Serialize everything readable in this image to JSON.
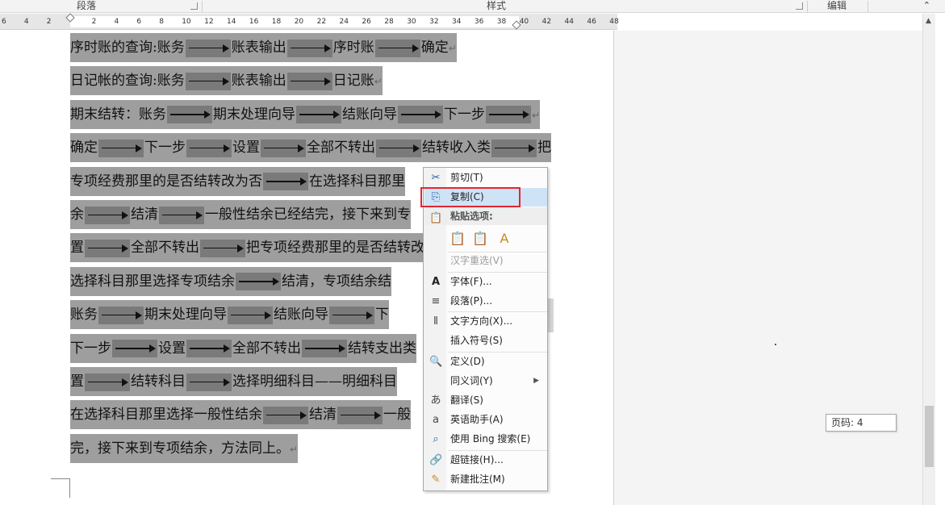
{
  "ribbon": {
    "groups": [
      {
        "label": "段落"
      },
      {
        "label": "样式"
      },
      {
        "label": "编辑"
      }
    ],
    "collapse_icon": "chevron-up-icon"
  },
  "ruler": {
    "ticks": [
      "6",
      "4",
      "2",
      "",
      "2",
      "4",
      "6",
      "8",
      "10",
      "12",
      "14",
      "16",
      "18",
      "20",
      "22",
      "24",
      "26",
      "28",
      "30",
      "32",
      "34",
      "36",
      "38",
      "40",
      "42",
      "44",
      "46",
      "48"
    ]
  },
  "document": {
    "lines": [
      [
        "序时账的查询:账务",
        "→",
        "账表输出",
        "→",
        "序时账",
        "→",
        "确定",
        "↵"
      ],
      [
        "日记帐的查询:账务",
        "→",
        "账表输出",
        "→",
        "日记账",
        "↵"
      ],
      [
        "期末结转：账务",
        "→",
        "期末处理向导",
        "→",
        "结账向导",
        "→",
        "下一步",
        "→",
        "↵"
      ],
      [
        "确定",
        "→",
        "下一步",
        "→",
        "设置",
        "→",
        "全部不转出",
        "→",
        "结转收入类",
        "→",
        "把"
      ],
      [
        "专项经费那里的是否结转改为否",
        "→",
        "在选择科目那里"
      ],
      [
        "余",
        "→",
        "结清",
        "→",
        "一般性结余已经结完，接下来到专"
      ],
      [
        "置",
        "→",
        "全部不转出",
        "→",
        "把专项经费那里的是否结转改"
      ],
      [
        "选择科目那里选择专项结余",
        "→",
        "结清，专项结余结"
      ],
      [
        "账务",
        "→",
        "期末处理向导",
        "→",
        "结账向导",
        "→",
        "下"
      ],
      [
        "下一步",
        "→",
        "设置",
        "→",
        "全部不转出",
        "→",
        "结转支出类"
      ],
      [
        "置",
        "→",
        "结转科目",
        "→",
        "选择明细科目——明细科目"
      ],
      [
        "在选择科目那里选择一般性结余",
        "→",
        "结清",
        "→",
        "一般"
      ],
      [
        "完，接下来到专项结余，方法同上。",
        "↵"
      ]
    ]
  },
  "context_menu": {
    "cut": {
      "label": "剪切(T)",
      "icon": "scissors-icon"
    },
    "copy": {
      "label": "复制(C)",
      "icon": "copy-icon"
    },
    "paste_options": {
      "label": "粘贴选项:",
      "icon": "clipboard-icon"
    },
    "paste_buttons": [
      {
        "icon": "paste-keep-formatting-icon"
      },
      {
        "icon": "paste-merge-formatting-icon"
      },
      {
        "icon": "paste-text-only-icon"
      }
    ],
    "reconvert": {
      "label": "汉字重选(V)"
    },
    "font": {
      "label": "字体(F)...",
      "icon": "font-icon"
    },
    "paragraph": {
      "label": "段落(P)...",
      "icon": "paragraph-icon"
    },
    "text_direction": {
      "label": "文字方向(X)...",
      "icon": "text-direction-icon"
    },
    "insert_symbol": {
      "label": "插入符号(S)"
    },
    "define": {
      "label": "定义(D)",
      "icon": "define-icon"
    },
    "synonyms": {
      "label": "同义词(Y)",
      "icon": "submenu-arrow-icon"
    },
    "translate": {
      "label": "翻译(S)",
      "icon": "translate-icon"
    },
    "english_assistant": {
      "label": "英语助手(A)",
      "icon": "english-assistant-icon"
    },
    "bing_search": {
      "label": "使用 Bing 搜索(E)",
      "icon": "bing-search-icon"
    },
    "hyperlink": {
      "label": "超链接(H)...",
      "icon": "hyperlink-icon"
    },
    "new_comment": {
      "label": "新建批注(M)",
      "icon": "new-comment-icon"
    }
  },
  "status": {
    "page_label": "页码: 4"
  },
  "colors": {
    "selection": "#9e9e9e",
    "arrow_highlight": "#7a7a7a",
    "menu_highlight": "#cfe3f7",
    "annotation_box": "#e3262f"
  }
}
